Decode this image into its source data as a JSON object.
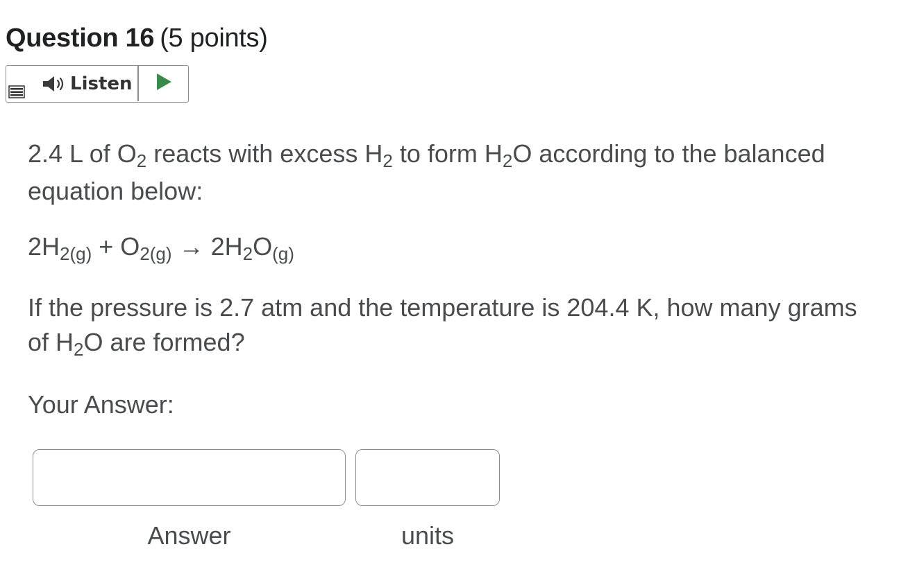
{
  "question": {
    "title": "Question 16",
    "points": "(5 points)"
  },
  "listen": {
    "label": "Listen"
  },
  "body": {
    "p1": {
      "a": "2.4 L of O",
      "a_sub": "2",
      "b": " reacts with excess H",
      "b_sub": "2",
      "c": " to form H",
      "c_sub": "2",
      "d": "O according to the balanced",
      "line2": "equation below:"
    },
    "equation": {
      "t1": "2H",
      "s1": "2(g)",
      "t2": " + O",
      "s2": "2(g)",
      "arrow": " → ",
      "t3": "2H",
      "s3": "2",
      "t4": "O",
      "s4": "(g)"
    },
    "p3": {
      "line1": "If the pressure is 2.7 atm and the temperature is 204.4 K, how many grams",
      "a": "of H",
      "a_sub": "2",
      "b": "O are formed?"
    }
  },
  "answer": {
    "heading": "Your Answer:",
    "answer_value": "",
    "units_value": "",
    "answer_label": "Answer",
    "units_label": "units"
  },
  "icons": {
    "menu": "menu-icon",
    "speaker": "speaker-icon",
    "play": "play-icon"
  },
  "colors": {
    "play": "#3c8a4a",
    "text": "#494c4e",
    "border": "#8a8d90"
  }
}
